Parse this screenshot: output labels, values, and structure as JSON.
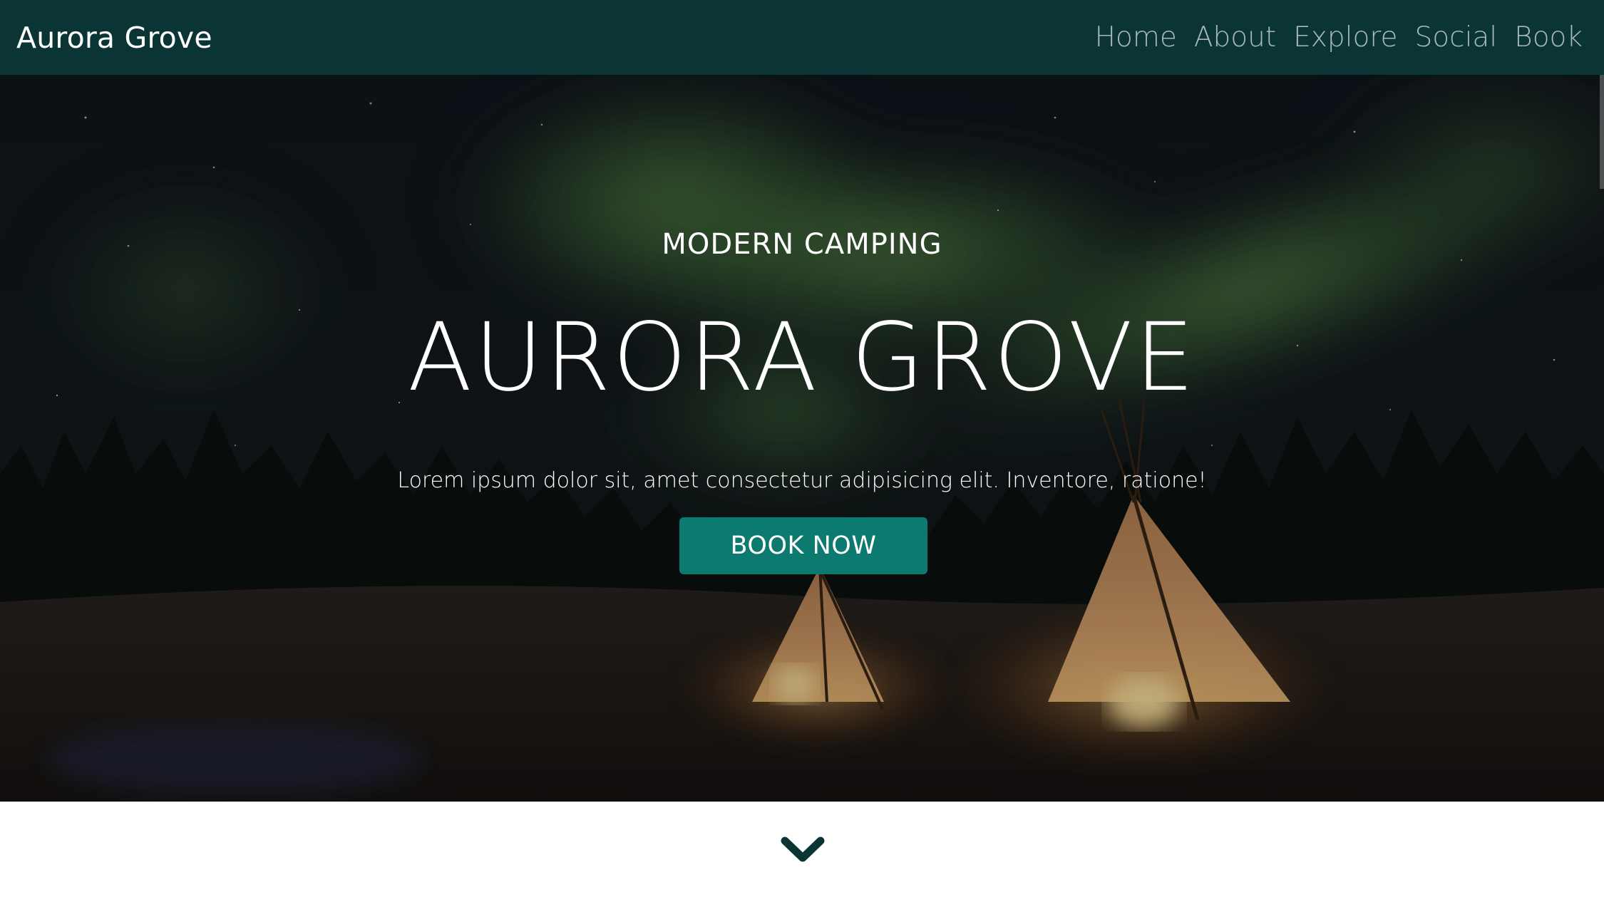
{
  "navbar": {
    "brand": "Aurora Grove",
    "links": [
      {
        "label": "Home"
      },
      {
        "label": "About"
      },
      {
        "label": "Explore"
      },
      {
        "label": "Social"
      },
      {
        "label": "Book"
      }
    ]
  },
  "hero": {
    "subtitle": "MODERN CAMPING",
    "title": "AURORA GROVE",
    "tagline": "Lorem ipsum dolor sit, amet consectetur adipisicing elit. Inventore, ratione!",
    "button_label": "BOOK NOW",
    "background_image": "aurora-borealis-night-sky-with-lit-teepee-tents-in-snowy-forest"
  },
  "scroll_indicator": {
    "icon": "chevron-down-icon"
  },
  "colors": {
    "navbar_bg": "#0b3535",
    "nav_link": "#a9b9b9",
    "button_bg": "#0d7a70",
    "chevron": "#0b3535"
  }
}
